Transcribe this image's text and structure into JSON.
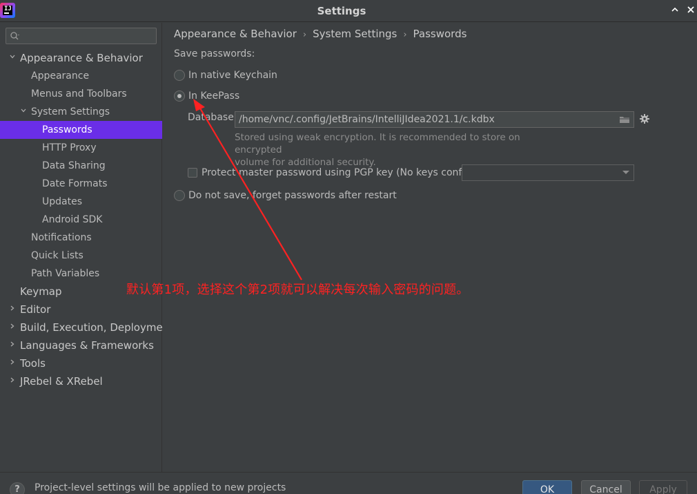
{
  "window": {
    "title": "Settings",
    "app_icon_text": "IJ"
  },
  "sidebar": {
    "search_placeholder": "Q▾",
    "items": [
      {
        "label": "Appearance & Behavior",
        "level": 0,
        "expanded": true
      },
      {
        "label": "Appearance",
        "level": 1
      },
      {
        "label": "Menus and Toolbars",
        "level": 1
      },
      {
        "label": "System Settings",
        "level": 1,
        "expanded": true
      },
      {
        "label": "Passwords",
        "level": 2,
        "selected": true
      },
      {
        "label": "HTTP Proxy",
        "level": 2
      },
      {
        "label": "Data Sharing",
        "level": 2
      },
      {
        "label": "Date Formats",
        "level": 2
      },
      {
        "label": "Updates",
        "level": 2
      },
      {
        "label": "Android SDK",
        "level": 2
      },
      {
        "label": "Notifications",
        "level": 1
      },
      {
        "label": "Quick Lists",
        "level": 1
      },
      {
        "label": "Path Variables",
        "level": 1
      },
      {
        "label": "Keymap",
        "level": 0
      },
      {
        "label": "Editor",
        "level": 0,
        "expanded": false
      },
      {
        "label": "Build, Execution, Deploymen",
        "level": 0,
        "expanded": false
      },
      {
        "label": "Languages & Frameworks",
        "level": 0,
        "expanded": false
      },
      {
        "label": "Tools",
        "level": 0,
        "expanded": false
      },
      {
        "label": "JRebel & XRebel",
        "level": 0,
        "expanded": false
      }
    ]
  },
  "main": {
    "breadcrumb": [
      "Appearance & Behavior",
      "System Settings",
      "Passwords"
    ],
    "breadcrumb_separator": "›",
    "save_passwords_label": "Save passwords:",
    "options": [
      {
        "label": "In native Keychain",
        "checked": false
      },
      {
        "label": "In KeePass",
        "checked": true
      },
      {
        "label": "Do not save, forget passwords after restart",
        "checked": false
      }
    ],
    "database_label": "Database:",
    "database_value": "/home/vnc/.config/JetBrains/IntelliJIdea2021.1/c.kdbx",
    "hint_line1": "Stored using weak encryption. It is recommended to store on encrypted",
    "hint_line2": "volume for additional security.",
    "pgp_label": "Protect master password using PGP key (No keys configured)",
    "pgp_checked": false,
    "pgp_select_value": ""
  },
  "annotation": {
    "text": "默认第1项，选择这个第2项就可以解决每次输入密码的问题。",
    "color": "#ff2222"
  },
  "footer": {
    "help_label": "?",
    "text": "Project-level settings will be applied to new projects",
    "ok_label": "OK",
    "cancel_label": "Cancel",
    "apply_label": "Apply"
  },
  "colors": {
    "background": "#3c3f41",
    "selection": "#6a2ee8",
    "text": "#bbbbbb",
    "primary_button": "#365880"
  }
}
